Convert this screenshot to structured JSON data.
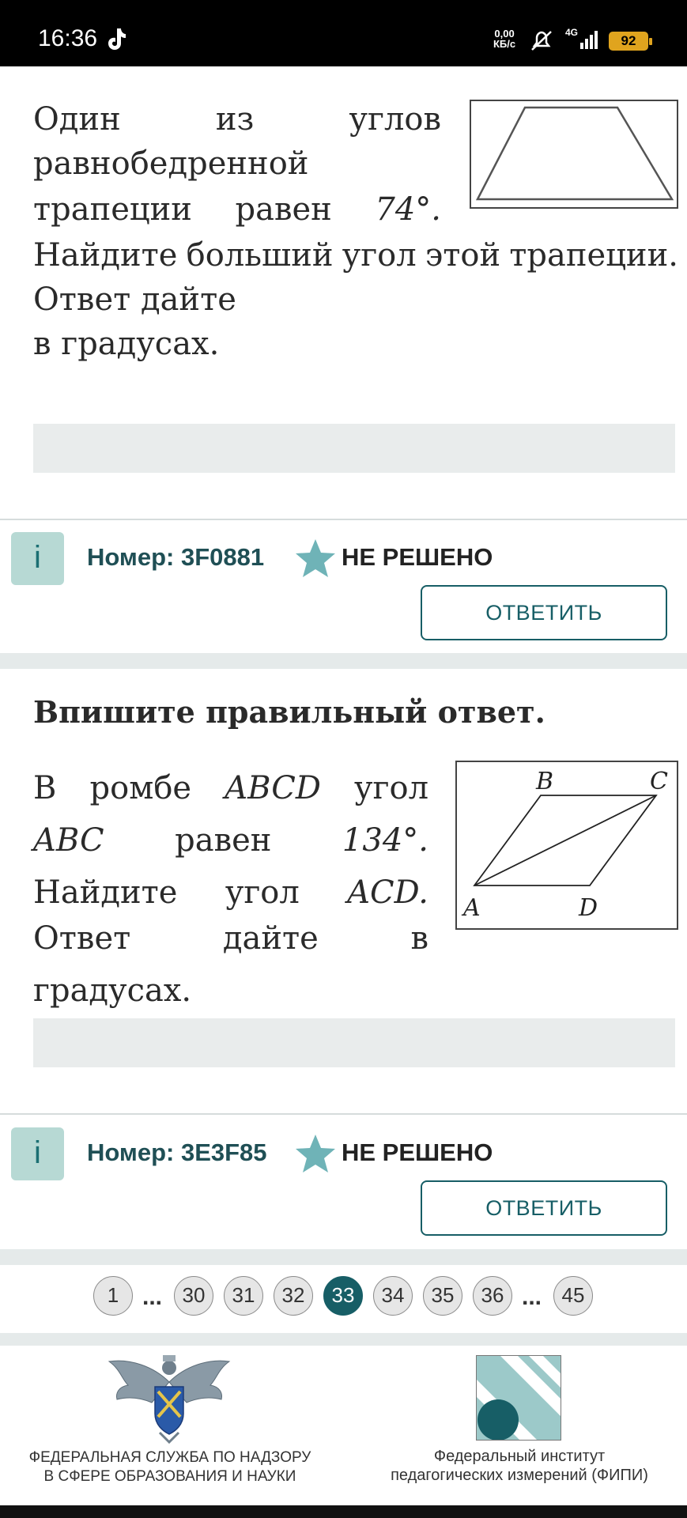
{
  "status_bar": {
    "time": "16:36",
    "net_speed_value": "0,00",
    "net_speed_unit": "КБ/с",
    "network": "4G",
    "battery": "92"
  },
  "problem1": {
    "line1": [
      "Один",
      "из",
      "углов"
    ],
    "line2": "равнобедренной",
    "line3_words": [
      "трапеции",
      "равен"
    ],
    "angle": "74°.",
    "line4": [
      "Найдите",
      "больший",
      "угол",
      "этой",
      "трапеции."
    ],
    "line5": "Ответ дайте",
    "line6": "в градусах.",
    "number": "Номер: 3F0881",
    "status": "НЕ РЕШЕНО",
    "reply_label": "ОТВЕТИТЬ"
  },
  "problem2": {
    "section_title": "Впишите правильный ответ.",
    "line1_a": "В",
    "line1_b": "ромбе",
    "line1_c": "ABCD",
    "line1_d": "угол",
    "line2_a": "ABC",
    "line2_b": "равен",
    "line2_c": "134°.",
    "line3_a": "Найдите",
    "line3_b": "угол",
    "line3_c": "ACD.",
    "line4": "Ответ дайте в градусах.",
    "fig_labels": {
      "a": "A",
      "b": "B",
      "c": "C",
      "d": "D"
    },
    "number": "Номер: 3E3F85",
    "status": "НЕ РЕШЕНО",
    "reply_label": "ОТВЕТИТЬ"
  },
  "pagination": {
    "pages": [
      "1",
      "30",
      "31",
      "32",
      "33",
      "34",
      "35",
      "36",
      "45"
    ],
    "active": "33",
    "ellipsis": "..."
  },
  "footer": {
    "left_line1": "ФЕДЕРАЛЬНАЯ СЛУЖБА ПО НАДЗОРУ",
    "left_line2": "В СФЕРЕ ОБРАЗОВАНИЯ И НАУКИ",
    "right_line1": "Федеральный институт",
    "right_line2": "педагогических измерений (ФИПИ)"
  },
  "colors": {
    "accent": "#175e66",
    "info_bg": "#b7d9d4",
    "band": "#e5eaea"
  },
  "icons": [
    "tiktok-icon",
    "mute-icon",
    "signal-icon",
    "battery-icon",
    "info-icon",
    "star-icon",
    "eagle-emblem-icon",
    "fipi-logo-icon"
  ]
}
